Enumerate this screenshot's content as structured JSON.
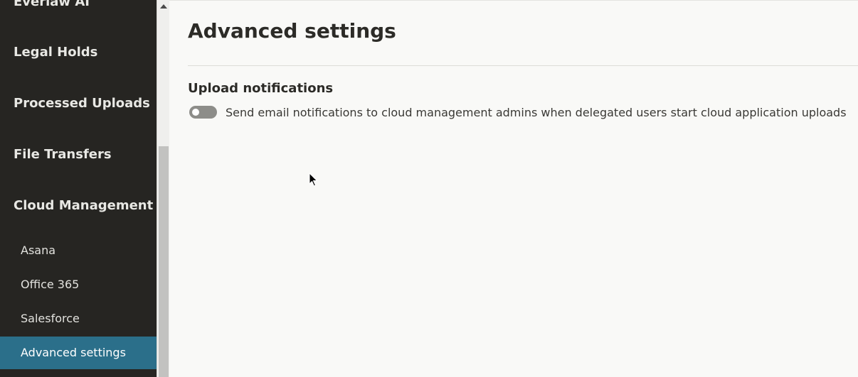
{
  "sidebar": {
    "top_items": [
      {
        "label": "Everlaw AI"
      },
      {
        "label": "Legal Holds"
      },
      {
        "label": "Processed Uploads"
      },
      {
        "label": "File Transfers"
      },
      {
        "label": "Cloud Management"
      }
    ],
    "sub_items": [
      {
        "label": "Asana",
        "active": false
      },
      {
        "label": "Office 365",
        "active": false
      },
      {
        "label": "Salesforce",
        "active": false
      },
      {
        "label": "Advanced settings",
        "active": true
      }
    ]
  },
  "main": {
    "title": "Advanced settings",
    "section": {
      "heading": "Upload notifications",
      "toggle": {
        "label": "Send email notifications to cloud management admins when delegated users start cloud application uploads",
        "on": false
      }
    }
  },
  "colors": {
    "sidebar_bg": "#262522",
    "active_bg": "#2b6f8a",
    "main_bg": "#f9f9f7",
    "toggle_off": "#8d8d89"
  },
  "icons": {
    "scroll_up": "triangle-up-icon",
    "cursor": "mouse-pointer-icon"
  }
}
